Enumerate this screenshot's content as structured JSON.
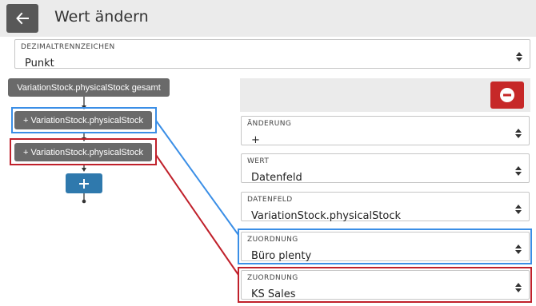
{
  "header": {
    "title": "Wert ändern"
  },
  "decimal_select": {
    "label": "DEZIMALTRENNZEICHEN",
    "value": "Punkt"
  },
  "tree": {
    "root": "VariationStock.physicalStock gesamt",
    "children": [
      "+ VariationStock.physicalStock",
      "+ VariationStock.physicalStock"
    ],
    "add_label": "+"
  },
  "fields": [
    {
      "label": "ÄNDERUNG",
      "value": "+"
    },
    {
      "label": "WERT",
      "value": "Datenfeld"
    },
    {
      "label": "DATENFELD",
      "value": "VariationStock.physicalStock"
    },
    {
      "label": "ZUORDNUNG",
      "value": "Büro plenty"
    },
    {
      "label": "ZUORDNUNG",
      "value": "KS Sales"
    }
  ],
  "colors": {
    "blue_highlight": "#3a8ee6",
    "red_highlight": "#c0212b",
    "remove_button": "#c62828",
    "add_button": "#2f79ad"
  },
  "icons": {
    "back": "arrow-left-icon",
    "remove": "minus-circle-icon",
    "add": "plus-icon",
    "sort": "sort-caret-icon"
  }
}
